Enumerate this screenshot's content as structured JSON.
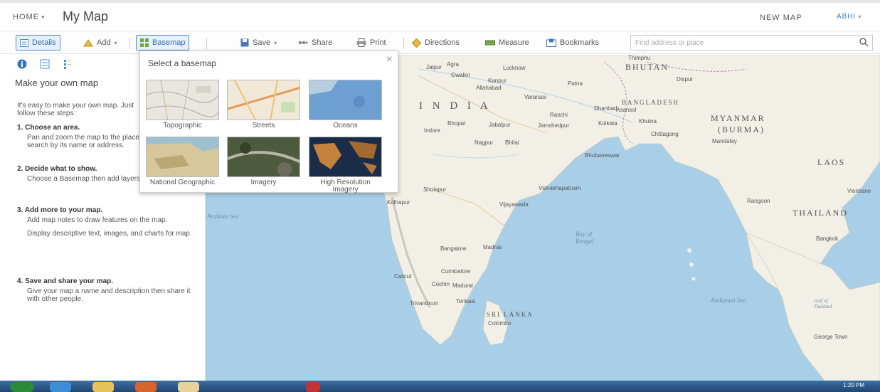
{
  "header": {
    "home_label": "HOME",
    "home_caret": "▾",
    "map_title": "My Map",
    "new_map_label": "NEW MAP",
    "user_label": "ABHI",
    "user_caret": "▾"
  },
  "toolbar": {
    "details_label": "Details",
    "add_label": "Add",
    "basemap_label": "Basemap",
    "save_label": "Save",
    "share_label": "Share",
    "print_label": "Print",
    "directions_label": "Directions",
    "measure_label": "Measure",
    "bookmarks_label": "Bookmarks",
    "caret": "▾",
    "search_placeholder": "Find address or place",
    "active_tool": "Basemap",
    "accent_color": "#4a8fd0"
  },
  "left_panel": {
    "tabs": [
      "about-icon",
      "legend-icon",
      "contents-icon"
    ],
    "title": "Make your own map",
    "intro": "It's easy to make your own map. Just follow these steps:",
    "steps": [
      {
        "title": "1. Choose an area.",
        "body": "Pan and zoom the map to the place you want or search by its name or address."
      },
      {
        "title": "2. Decide what to show.",
        "body": "Choose a Basemap then add layers on top of it."
      },
      {
        "title": "3. Add more to your map.",
        "body": "Add map notes to draw features on the map.",
        "body2": "Display descriptive text, images, and charts for map"
      },
      {
        "title": "4. Save and share your map.",
        "body": "Give your map a name and description then share it with other people."
      }
    ]
  },
  "basemap_popup": {
    "title": "Select a basemap",
    "close": "×",
    "options": [
      {
        "label": "Topographic"
      },
      {
        "label": "Streets"
      },
      {
        "label": "Oceans"
      },
      {
        "label": "National Geographic"
      },
      {
        "label": "Imagery"
      },
      {
        "label": "High Resolution Imagery"
      }
    ]
  },
  "map": {
    "labels": {
      "india": "I N D I A",
      "bhutan": "BHUTAN",
      "myanmar": "MYANMAR",
      "burma": "(BURMA)",
      "laos": "LAOS",
      "thailand": "THAILAND",
      "srilanka": "SRI LANKA",
      "bangladesh": "BANGLADESH",
      "bay_of_bengal": "Bay of Bengal",
      "arabian_sea": "Arabian Sea",
      "andaman_sea": "Andaman Sea",
      "gulf_thailand": "Gulf of Thailand",
      "cities": [
        "Agra",
        "Jaipur",
        "Gwalior",
        "Lucknow",
        "Kanpur",
        "Allahabad",
        "Patna",
        "Varanasi",
        "Dhanbad",
        "Ranchi",
        "Asansol",
        "Kolkata",
        "Khulna",
        "Bhopal",
        "Indore",
        "Jabalpur",
        "Jamshedpur",
        "Nagpur",
        "Bhilai",
        "Chittagong",
        "Mandalay",
        "Sholapur",
        "Kolhapur",
        "Bangalore",
        "Madras",
        "Calicut",
        "Coimbatore",
        "Cochin",
        "Madurai",
        "Trivandrum",
        "Tenkasi",
        "Colombo",
        "Vishakhapatnam",
        "Vijayawada",
        "Bhubaneswar",
        "Rangoon",
        "Bangkok",
        "Vientiane",
        "George Town",
        "Thimphu",
        "Dispur"
      ]
    },
    "land_color": "#f2efe6",
    "water_color": "#a9cfe8"
  },
  "taskbar": {
    "time": "1:20 PM"
  }
}
